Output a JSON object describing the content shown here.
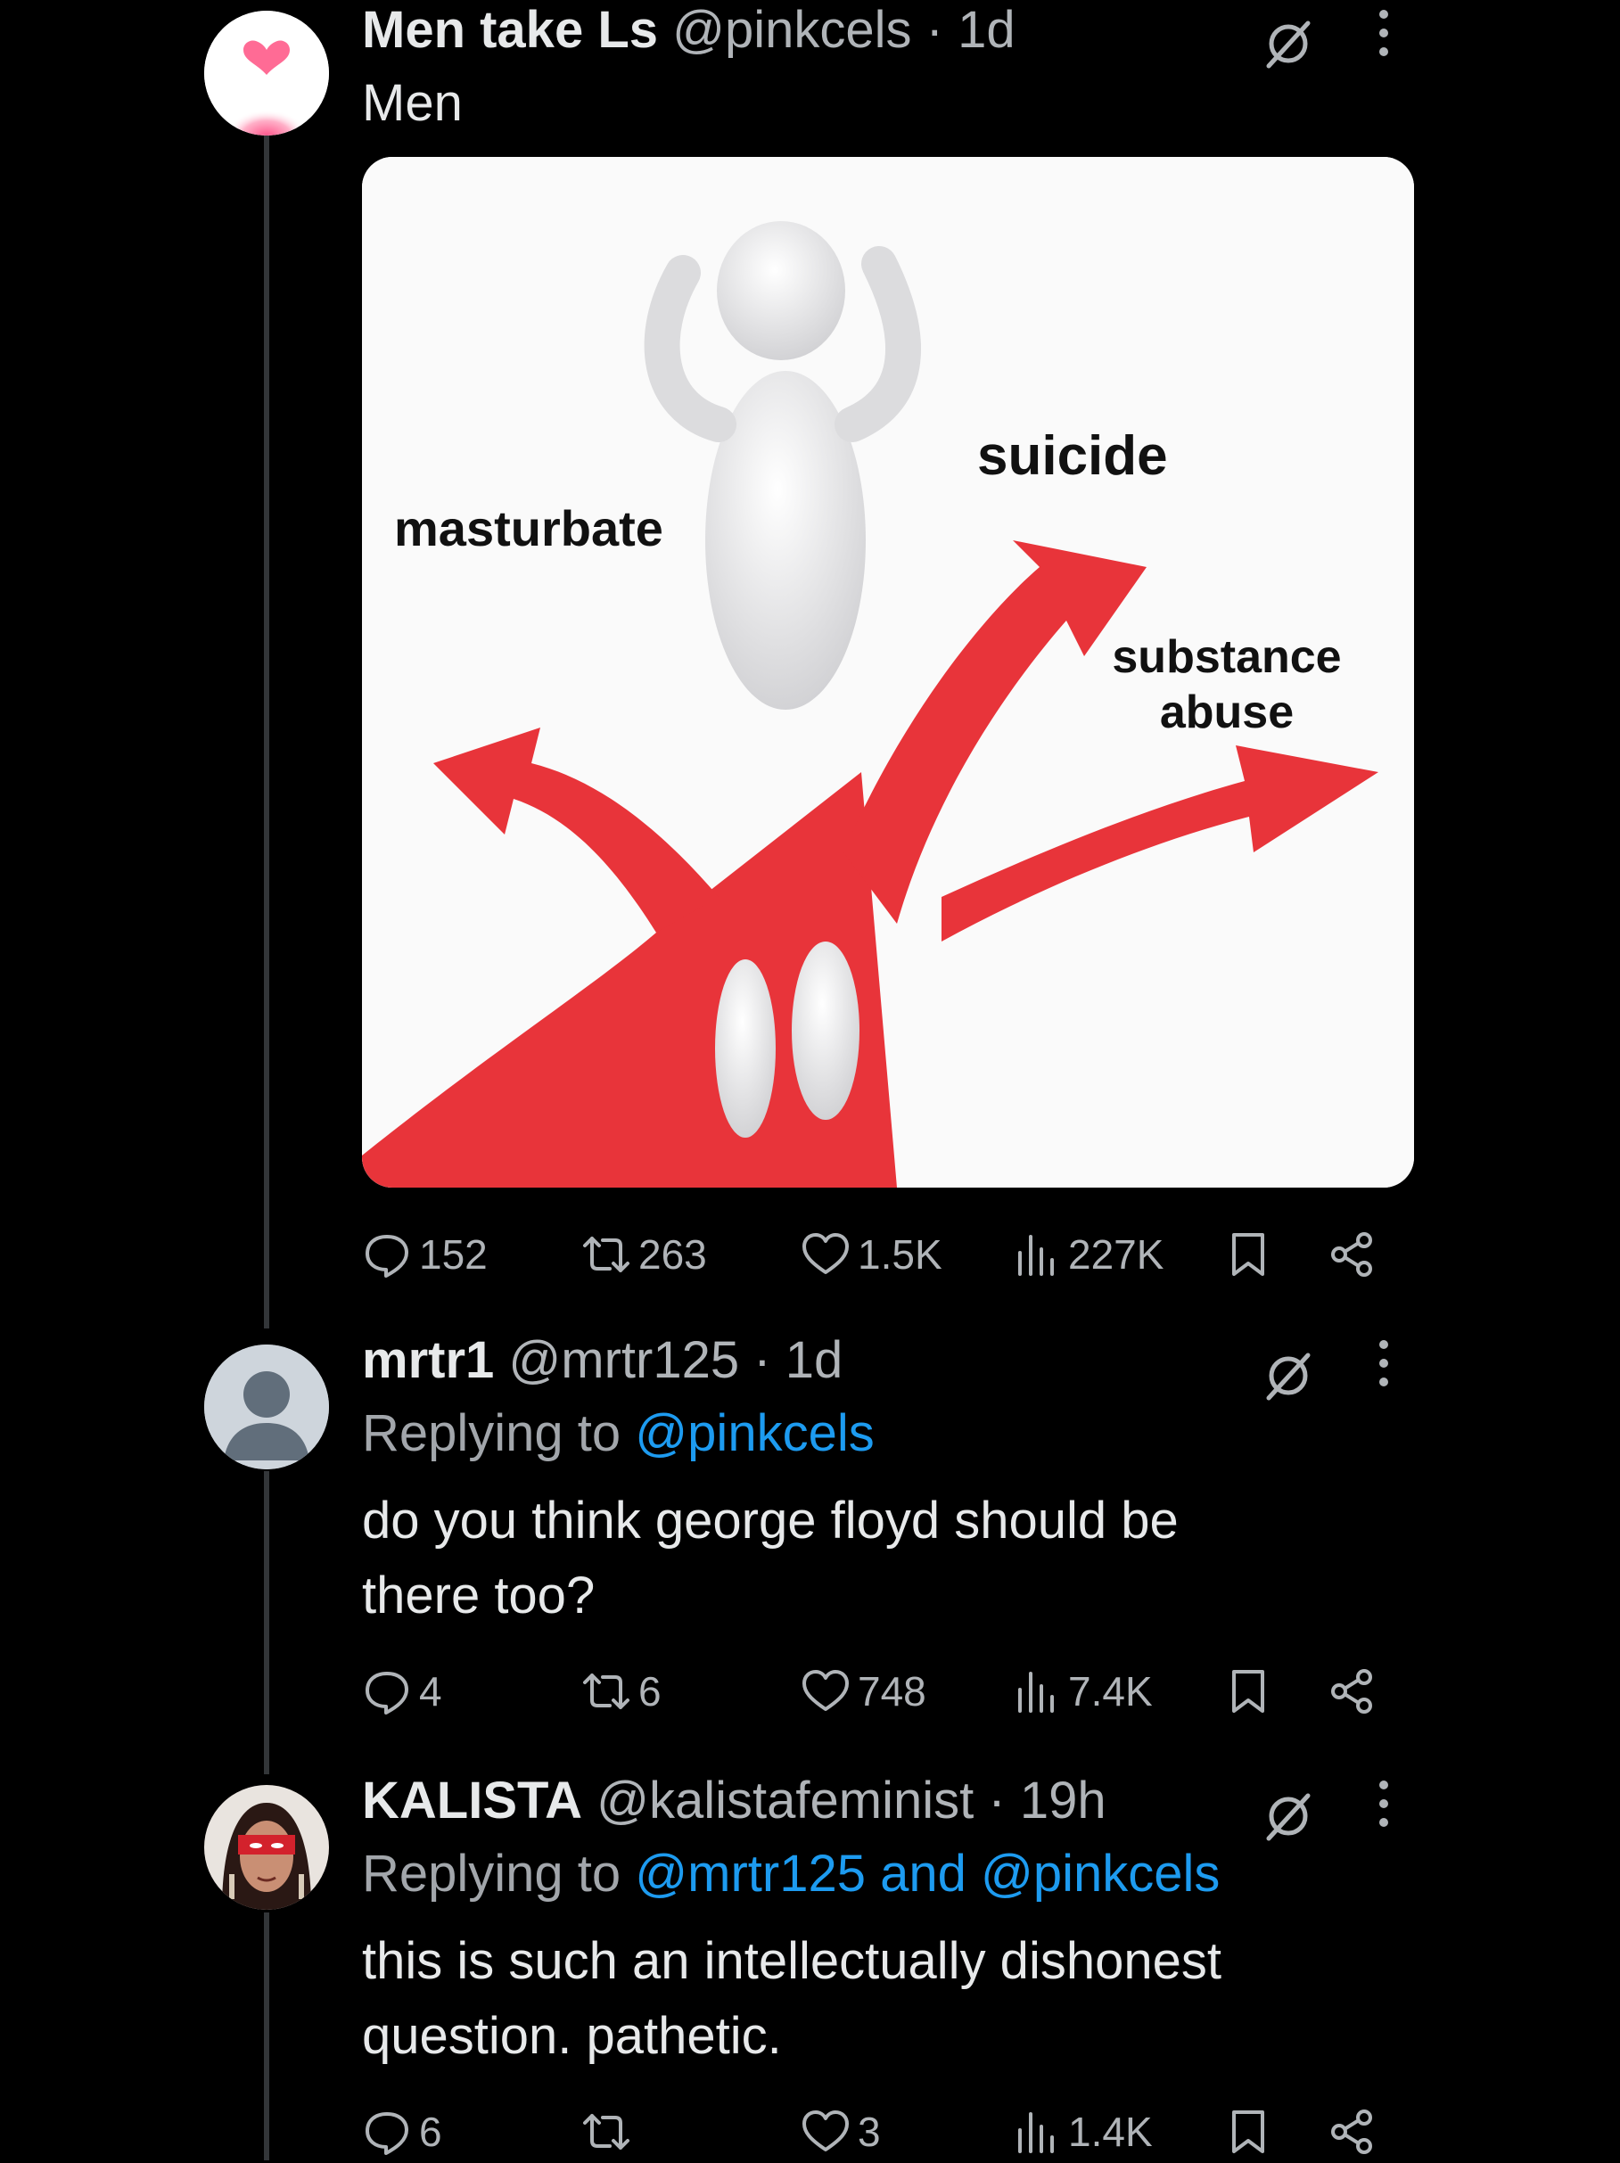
{
  "tweets": [
    {
      "display_name": "Men take Ls",
      "handle": "@pinkcels",
      "separator": "·",
      "time": "1d",
      "text": "Men",
      "media": {
        "labels": [
          "masturbate",
          "suicide",
          "substance abuse"
        ]
      },
      "stats": {
        "replies": "152",
        "retweets": "263",
        "likes": "1.5K",
        "views": "227K"
      }
    },
    {
      "display_name": "mrtr1",
      "handle": "@mrtr125",
      "separator": "·",
      "time": "1d",
      "replying_prefix": "Replying to",
      "replying_to": "@pinkcels",
      "text": "do you think george floyd should be there too?",
      "stats": {
        "replies": "4",
        "retweets": "6",
        "likes": "748",
        "views": "7.4K"
      }
    },
    {
      "display_name": "KALISTA",
      "handle": "@kalistafeminist",
      "separator": "·",
      "time": "19h",
      "replying_prefix": "Replying to",
      "replying_to": "@mrtr125 and @pinkcels",
      "text": "this is such an intellectually dishonest question. pathetic.",
      "stats": {
        "replies": "6",
        "retweets": "",
        "likes": "3",
        "views": "1.4K"
      }
    }
  ],
  "icons": [
    "reply-icon",
    "retweet-icon",
    "like-icon",
    "views-icon",
    "bookmark-icon",
    "share-icon",
    "grok-icon",
    "more-icon"
  ],
  "colors": {
    "background": "#000000",
    "text": "#e7e9ea",
    "muted": "#b0b4b8",
    "link": "#1d9bf0",
    "arrow_red": "#e8343a"
  }
}
